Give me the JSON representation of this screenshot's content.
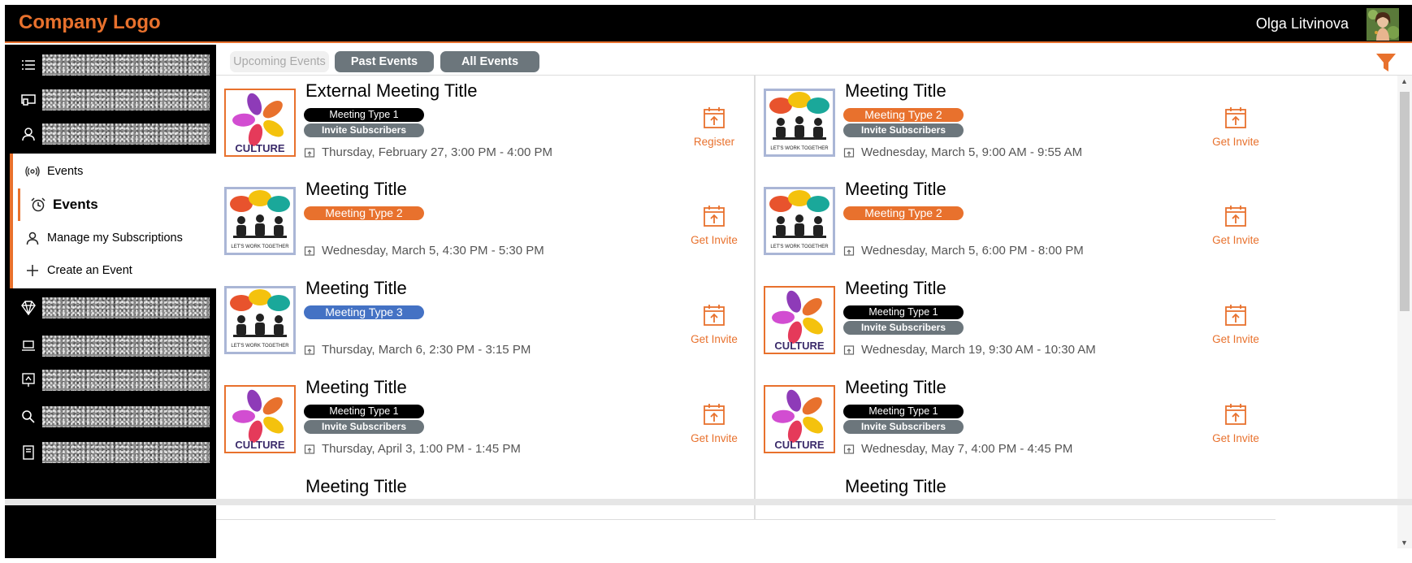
{
  "header": {
    "logo": "Company Logo",
    "user_name": "Olga Litvinova"
  },
  "sidebar": {
    "icons": [
      "list-icon",
      "screen-share-icon",
      "user-icon"
    ],
    "icons_bottom": [
      "diamond-icon",
      "laptop-icon",
      "presentation-icon",
      "search-icon",
      "notebook-icon"
    ],
    "submenu": {
      "header": "Events",
      "items": [
        {
          "label": "Events",
          "icon": "alarm-clock-icon",
          "selected": true
        },
        {
          "label": "Manage my Subscriptions",
          "icon": "user-icon"
        },
        {
          "label": "Create an Event",
          "icon": "plus-icon"
        }
      ]
    }
  },
  "tabs": [
    {
      "label": "Upcoming Events",
      "active": true
    },
    {
      "label": "Past Events"
    },
    {
      "label": "All Events"
    }
  ],
  "events": [
    {
      "title": "External Meeting Title",
      "image": "culture",
      "type": "Meeting Type 1",
      "type_style": "type1",
      "invite": "Invite Subscribers",
      "datetime": "Thursday, February 27, 3:00 PM - 4:00 PM",
      "action": "Register"
    },
    {
      "title": "Meeting Title",
      "image": "work",
      "type": "Meeting Type 2",
      "type_style": "type2",
      "invite": "Invite Subscribers",
      "datetime": "Wednesday, March 5, 9:00 AM - 9:55 AM",
      "action": "Get Invite"
    },
    {
      "title": "Meeting Title",
      "image": "work",
      "type": "Meeting Type 2",
      "type_style": "type2",
      "invite": "",
      "datetime": "Wednesday, March 5, 4:30 PM - 5:30 PM",
      "action": "Get Invite"
    },
    {
      "title": "Meeting Title",
      "image": "work",
      "type": "Meeting Type 2",
      "type_style": "type2",
      "invite": "",
      "datetime": "Wednesday, March 5, 6:00 PM - 8:00 PM",
      "action": "Get Invite"
    },
    {
      "title": "Meeting Title",
      "image": "work",
      "type": "Meeting Type 3",
      "type_style": "type3",
      "invite": "",
      "datetime": "Thursday, March 6, 2:30 PM - 3:15 PM",
      "action": "Get Invite"
    },
    {
      "title": "Meeting Title",
      "image": "culture",
      "type": "Meeting Type 1",
      "type_style": "type1",
      "invite": "Invite Subscribers",
      "datetime": "Wednesday, March 19, 9:30 AM - 10:30 AM",
      "action": "Get Invite"
    },
    {
      "title": "Meeting Title",
      "image": "culture",
      "type": "Meeting Type 1",
      "type_style": "type1",
      "invite": "Invite Subscribers",
      "datetime": "Thursday, April 3, 1:00 PM - 1:45 PM",
      "action": "Get Invite"
    },
    {
      "title": "Meeting Title",
      "image": "culture",
      "type": "Meeting Type 1",
      "type_style": "type1",
      "invite": "Invite Subscribers",
      "datetime": "Wednesday, May 7, 4:00 PM - 4:45 PM",
      "action": "Get Invite"
    },
    {
      "title": "Meeting Title",
      "image": "",
      "type": "",
      "type_style": "",
      "invite": "",
      "datetime": "",
      "action": ""
    },
    {
      "title": "Meeting Title",
      "image": "",
      "type": "",
      "type_style": "",
      "invite": "",
      "datetime": "",
      "action": ""
    }
  ],
  "images": {
    "culture_label": "CULTURE",
    "work_label": "LET'S WORK TOGETHER"
  },
  "colors": {
    "accent": "#e8712d",
    "header_bg": "#000000",
    "tab_gray": "#6c767c",
    "type3_blue": "#4472c4"
  }
}
